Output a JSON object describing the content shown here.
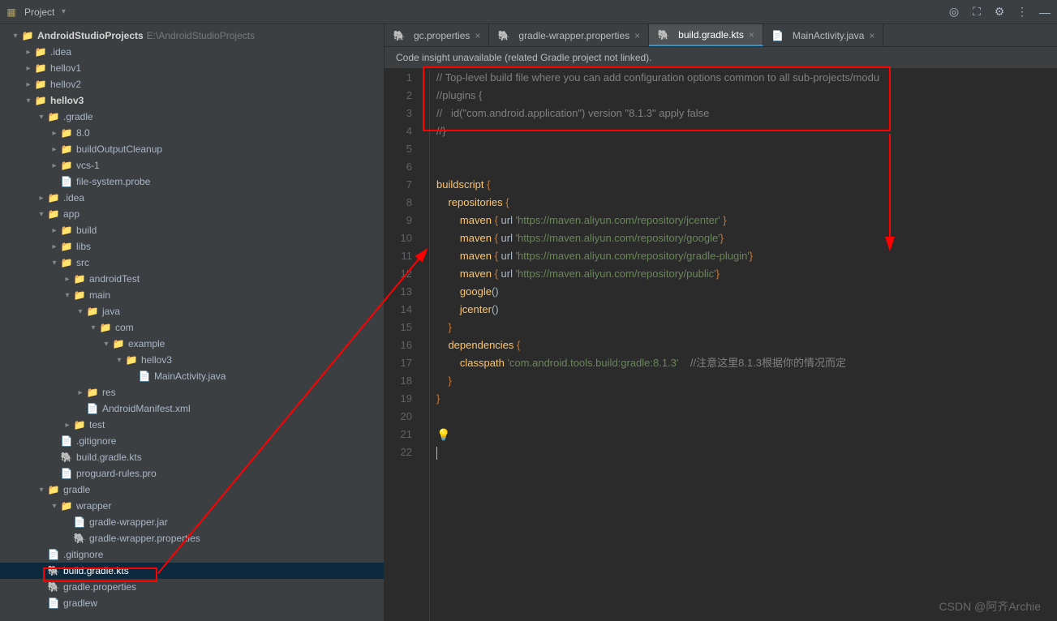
{
  "toolbar": {
    "project_label": "Project"
  },
  "project": {
    "root": {
      "name": "AndroidStudioProjects",
      "path": "E:\\AndroidStudioProjects"
    },
    "tree": [
      {
        "depth": 0,
        "chev": "v",
        "icon": "module",
        "label": "AndroidStudioProjects",
        "suffix": " E:\\AndroidStudioProjects",
        "bold": true
      },
      {
        "depth": 1,
        "chev": ">",
        "icon": "folder",
        "label": ".idea"
      },
      {
        "depth": 1,
        "chev": ">",
        "icon": "folder",
        "label": "hellov1"
      },
      {
        "depth": 1,
        "chev": ">",
        "icon": "folder",
        "label": "hellov2"
      },
      {
        "depth": 1,
        "chev": "v",
        "icon": "folder",
        "label": "hellov3",
        "bold": true
      },
      {
        "depth": 2,
        "chev": "v",
        "icon": "folder",
        "label": ".gradle"
      },
      {
        "depth": 3,
        "chev": ">",
        "icon": "folder",
        "label": "8.0"
      },
      {
        "depth": 3,
        "chev": ">",
        "icon": "folder",
        "label": "buildOutputCleanup"
      },
      {
        "depth": 3,
        "chev": ">",
        "icon": "folder",
        "label": "vcs-1"
      },
      {
        "depth": 3,
        "chev": "",
        "icon": "file",
        "label": "file-system.probe"
      },
      {
        "depth": 2,
        "chev": ">",
        "icon": "folder",
        "label": ".idea"
      },
      {
        "depth": 2,
        "chev": "v",
        "icon": "folder",
        "label": "app"
      },
      {
        "depth": 3,
        "chev": ">",
        "icon": "folder",
        "label": "build"
      },
      {
        "depth": 3,
        "chev": ">",
        "icon": "folder",
        "label": "libs"
      },
      {
        "depth": 3,
        "chev": "v",
        "icon": "folder",
        "label": "src"
      },
      {
        "depth": 4,
        "chev": ">",
        "icon": "folder",
        "label": "androidTest"
      },
      {
        "depth": 4,
        "chev": "v",
        "icon": "folder",
        "label": "main"
      },
      {
        "depth": 5,
        "chev": "v",
        "icon": "folder",
        "label": "java"
      },
      {
        "depth": 6,
        "chev": "v",
        "icon": "folder",
        "label": "com"
      },
      {
        "depth": 7,
        "chev": "v",
        "icon": "folder",
        "label": "example"
      },
      {
        "depth": 8,
        "chev": "v",
        "icon": "folder",
        "label": "hellov3"
      },
      {
        "depth": 9,
        "chev": "",
        "icon": "file",
        "label": "MainActivity.java"
      },
      {
        "depth": 5,
        "chev": ">",
        "icon": "folder",
        "label": "res"
      },
      {
        "depth": 5,
        "chev": "",
        "icon": "file",
        "label": "AndroidManifest.xml"
      },
      {
        "depth": 4,
        "chev": ">",
        "icon": "folder",
        "label": "test"
      },
      {
        "depth": 3,
        "chev": "",
        "icon": "file",
        "label": ".gitignore"
      },
      {
        "depth": 3,
        "chev": "",
        "icon": "gradle",
        "label": "build.gradle.kts"
      },
      {
        "depth": 3,
        "chev": "",
        "icon": "file",
        "label": "proguard-rules.pro"
      },
      {
        "depth": 2,
        "chev": "v",
        "icon": "folder",
        "label": "gradle"
      },
      {
        "depth": 3,
        "chev": "v",
        "icon": "folder",
        "label": "wrapper"
      },
      {
        "depth": 4,
        "chev": "",
        "icon": "file",
        "label": "gradle-wrapper.jar"
      },
      {
        "depth": 4,
        "chev": "",
        "icon": "gradle",
        "label": "gradle-wrapper.properties"
      },
      {
        "depth": 2,
        "chev": "",
        "icon": "file",
        "label": ".gitignore"
      },
      {
        "depth": 2,
        "chev": "",
        "icon": "gradle",
        "label": "build.gradle.kts",
        "selected": true
      },
      {
        "depth": 2,
        "chev": "",
        "icon": "gradle",
        "label": "gradle.properties"
      },
      {
        "depth": 2,
        "chev": "",
        "icon": "file",
        "label": "gradlew"
      }
    ]
  },
  "tabs": [
    {
      "label": "gc.properties",
      "icon": "gradle"
    },
    {
      "label": "gradle-wrapper.properties",
      "icon": "gradle"
    },
    {
      "label": "build.gradle.kts",
      "icon": "gradle",
      "active": true
    },
    {
      "label": "MainActivity.java",
      "icon": "file"
    }
  ],
  "banner": "Code insight unavailable (related Gradle project not linked).",
  "code": {
    "lines": [
      {
        "n": 1,
        "html": "<span class='c'>// Top-level build file where you can add configuration options common to all sub-projects/modu</span>"
      },
      {
        "n": 2,
        "html": "<span class='c'>//plugins {</span>"
      },
      {
        "n": 3,
        "html": "<span class='c'>//   id(\"com.android.application\") version \"8.1.3\" apply false</span>"
      },
      {
        "n": 4,
        "html": "<span class='c'>//}</span>"
      },
      {
        "n": 5,
        "html": ""
      },
      {
        "n": 6,
        "html": ""
      },
      {
        "n": 7,
        "html": "<span class='fn'>buildscript</span> <span class='k'>{</span>"
      },
      {
        "n": 8,
        "html": "    <span class='fn'>repositories</span> <span class='k'>{</span>"
      },
      {
        "n": 9,
        "html": "        <span class='fn'>maven</span> <span class='k'>{</span> url <span class='s'>'https://maven.aliyun.com/repository/jcenter'</span> <span class='k'>}</span>"
      },
      {
        "n": 10,
        "html": "        <span class='fn'>maven</span> <span class='k'>{</span> url <span class='s'>'https://maven.aliyun.com/repository/google'</span><span class='k'>}</span>"
      },
      {
        "n": 11,
        "html": "        <span class='fn'>maven</span> <span class='k'>{</span> url <span class='s'>'https://maven.aliyun.com/repository/gradle-plugin'</span><span class='k'>}</span>"
      },
      {
        "n": 12,
        "html": "        <span class='fn'>maven</span> <span class='k'>{</span> url <span class='s'>'https://maven.aliyun.com/repository/public'</span><span class='k'>}</span>"
      },
      {
        "n": 13,
        "html": "        <span class='fn'>google</span>()"
      },
      {
        "n": 14,
        "html": "        <span class='fn'>jcenter</span>()"
      },
      {
        "n": 15,
        "html": "    <span class='k'>}</span>"
      },
      {
        "n": 16,
        "html": "    <span class='fn'>dependencies</span> <span class='k'>{</span>"
      },
      {
        "n": 17,
        "html": "        <span class='fn'>classpath</span> <span class='s'>'com.android.tools.build:gradle:8.1.3'</span>    <span class='c'>//注意这里8.1.3根据你的情况而定</span>"
      },
      {
        "n": 18,
        "html": "    <span class='k'>}</span>"
      },
      {
        "n": 19,
        "html": "<span class='k'>}</span>"
      },
      {
        "n": 20,
        "html": ""
      },
      {
        "n": 21,
        "html": "<span class='lightbulb'>💡</span>"
      },
      {
        "n": 22,
        "html": "<span class='cursor'></span>"
      }
    ]
  },
  "watermark": "CSDN @阿齐Archie"
}
